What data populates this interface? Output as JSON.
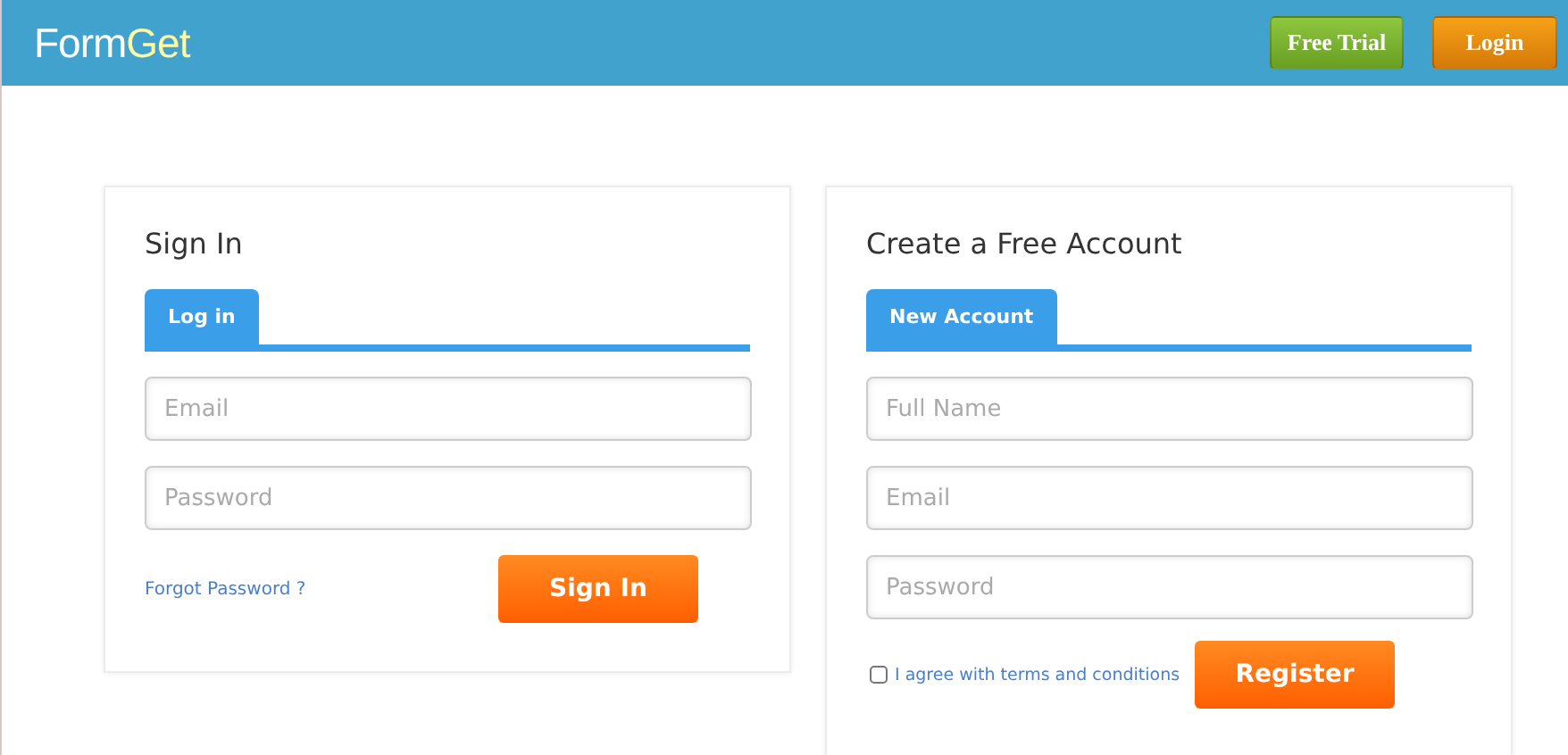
{
  "header": {
    "logo": {
      "text_1": "Form",
      "text_2": "Get"
    },
    "buttons": [
      {
        "label": "Free Trial",
        "kind": "trial"
      },
      {
        "label": "Login",
        "kind": "login"
      }
    ]
  },
  "sign_in": {
    "title": "Sign In",
    "tabs": [
      {
        "label": "Log in",
        "selected": true
      }
    ],
    "fields": [
      {
        "placeholder": "Email"
      },
      {
        "placeholder": "Password"
      }
    ],
    "link": "Forgot Password ?",
    "button": "Sign In"
  },
  "create_account": {
    "title": "Create a Free Account",
    "tabs": [
      {
        "label": "New Account",
        "selected": true
      }
    ],
    "fields": [
      {
        "placeholder": "Full Name"
      },
      {
        "placeholder": "Email"
      },
      {
        "placeholder": "Password"
      }
    ],
    "checkbox": {
      "label": "I agree with terms and conditions",
      "checked": false
    },
    "button": "Register"
  }
}
